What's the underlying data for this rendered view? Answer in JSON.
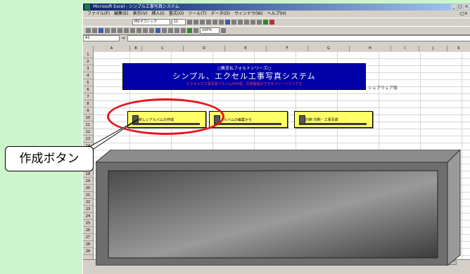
{
  "window": {
    "title": "Microsoft Excel - シンプル工事写真システム"
  },
  "menubar": {
    "items": [
      "ファイル(F)",
      "編集(E)",
      "表示(V)",
      "挿入(I)",
      "書式(O)",
      "ツール(T)",
      "データ(D)",
      "ウィンドウ(W)",
      "ヘルプ(H)"
    ]
  },
  "toolbar": {
    "font_name": "MS Pゴシック",
    "font_size": "11",
    "zoom": "100%"
  },
  "formula_bar": {
    "name_box": "A1",
    "value": ""
  },
  "columns": [
    "A",
    "B",
    "C",
    "D",
    "E",
    "F",
    "G",
    "H",
    "I",
    "J",
    "K",
    "L",
    "M"
  ],
  "rows": [
    "1",
    "2",
    "3",
    "4",
    "5",
    "6",
    "7",
    "8",
    "9",
    "10",
    "11",
    "12",
    "13",
    "14",
    "15",
    "16",
    "17",
    "18",
    "19",
    "20",
    "21",
    "22",
    "23",
    "24",
    "25",
    "26",
    "27",
    "28",
    "29"
  ],
  "banner": {
    "subtitle": "○無支払フォルトシリーズ○",
    "title": "シンプル、エクセル工事写真システム",
    "note": "エクセルで工事写真アルバムの作成、写真整理ができるフリーソフトです"
  },
  "side_label": "シェアウェア版",
  "buttons": [
    {
      "label": "新しいアルバムの作成"
    },
    {
      "label": "アルバムの編集から"
    },
    {
      "label": "印刷 印刷・工事写真"
    }
  ],
  "callout": {
    "text": "作成ボタン"
  },
  "colors": {
    "banner_bg": "#0000a8",
    "button_bg": "#ffff66",
    "circle": "#e8141c",
    "background": "#ccf5cc"
  }
}
